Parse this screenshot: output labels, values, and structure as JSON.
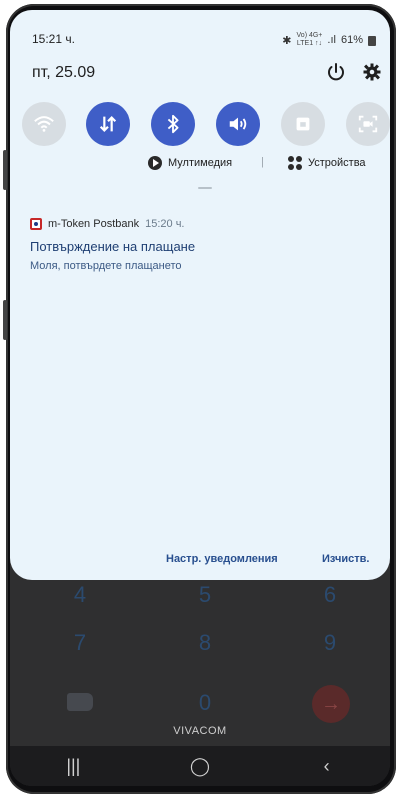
{
  "status_bar": {
    "time": "15:21 ч.",
    "network_top": "Vo) 4G+",
    "network_bottom": "LTE1 ↑↓",
    "battery": "61%"
  },
  "header": {
    "date": "пт, 25.09"
  },
  "quick_settings": [
    {
      "name": "wifi",
      "state": "off",
      "icon": "wifi-icon"
    },
    {
      "name": "mobile-data",
      "state": "on",
      "icon": "data-arrows-icon"
    },
    {
      "name": "bluetooth",
      "state": "on",
      "icon": "bluetooth-icon"
    },
    {
      "name": "sound",
      "state": "on",
      "icon": "volume-icon"
    },
    {
      "name": "screen-lock",
      "state": "off",
      "icon": "lock-rotation-icon"
    },
    {
      "name": "screen-recorder",
      "state": "off",
      "icon": "screen-record-icon"
    }
  ],
  "media_row": {
    "media_label": "Мултимедия",
    "devices_label": "Устройства"
  },
  "notification": {
    "app_name": "m-Token Postbank",
    "time": "15:20 ч.",
    "title": "Потвърждение на плащане",
    "body": "Моля, потвърдете плащането"
  },
  "actions": {
    "notification_settings": "Настр. уведомления",
    "clear": "Изчиств."
  },
  "dialer": {
    "keys_row1": [
      "4",
      "5",
      "6"
    ],
    "keys_row2": [
      "7",
      "8",
      "9"
    ],
    "zero": "0",
    "carrier": "VIVACOM"
  },
  "colors": {
    "shade_bg": "#eaf4fb",
    "tile_on": "#3f5ec7",
    "tile_off": "#d7dde2",
    "accent_text": "#284f8f"
  }
}
